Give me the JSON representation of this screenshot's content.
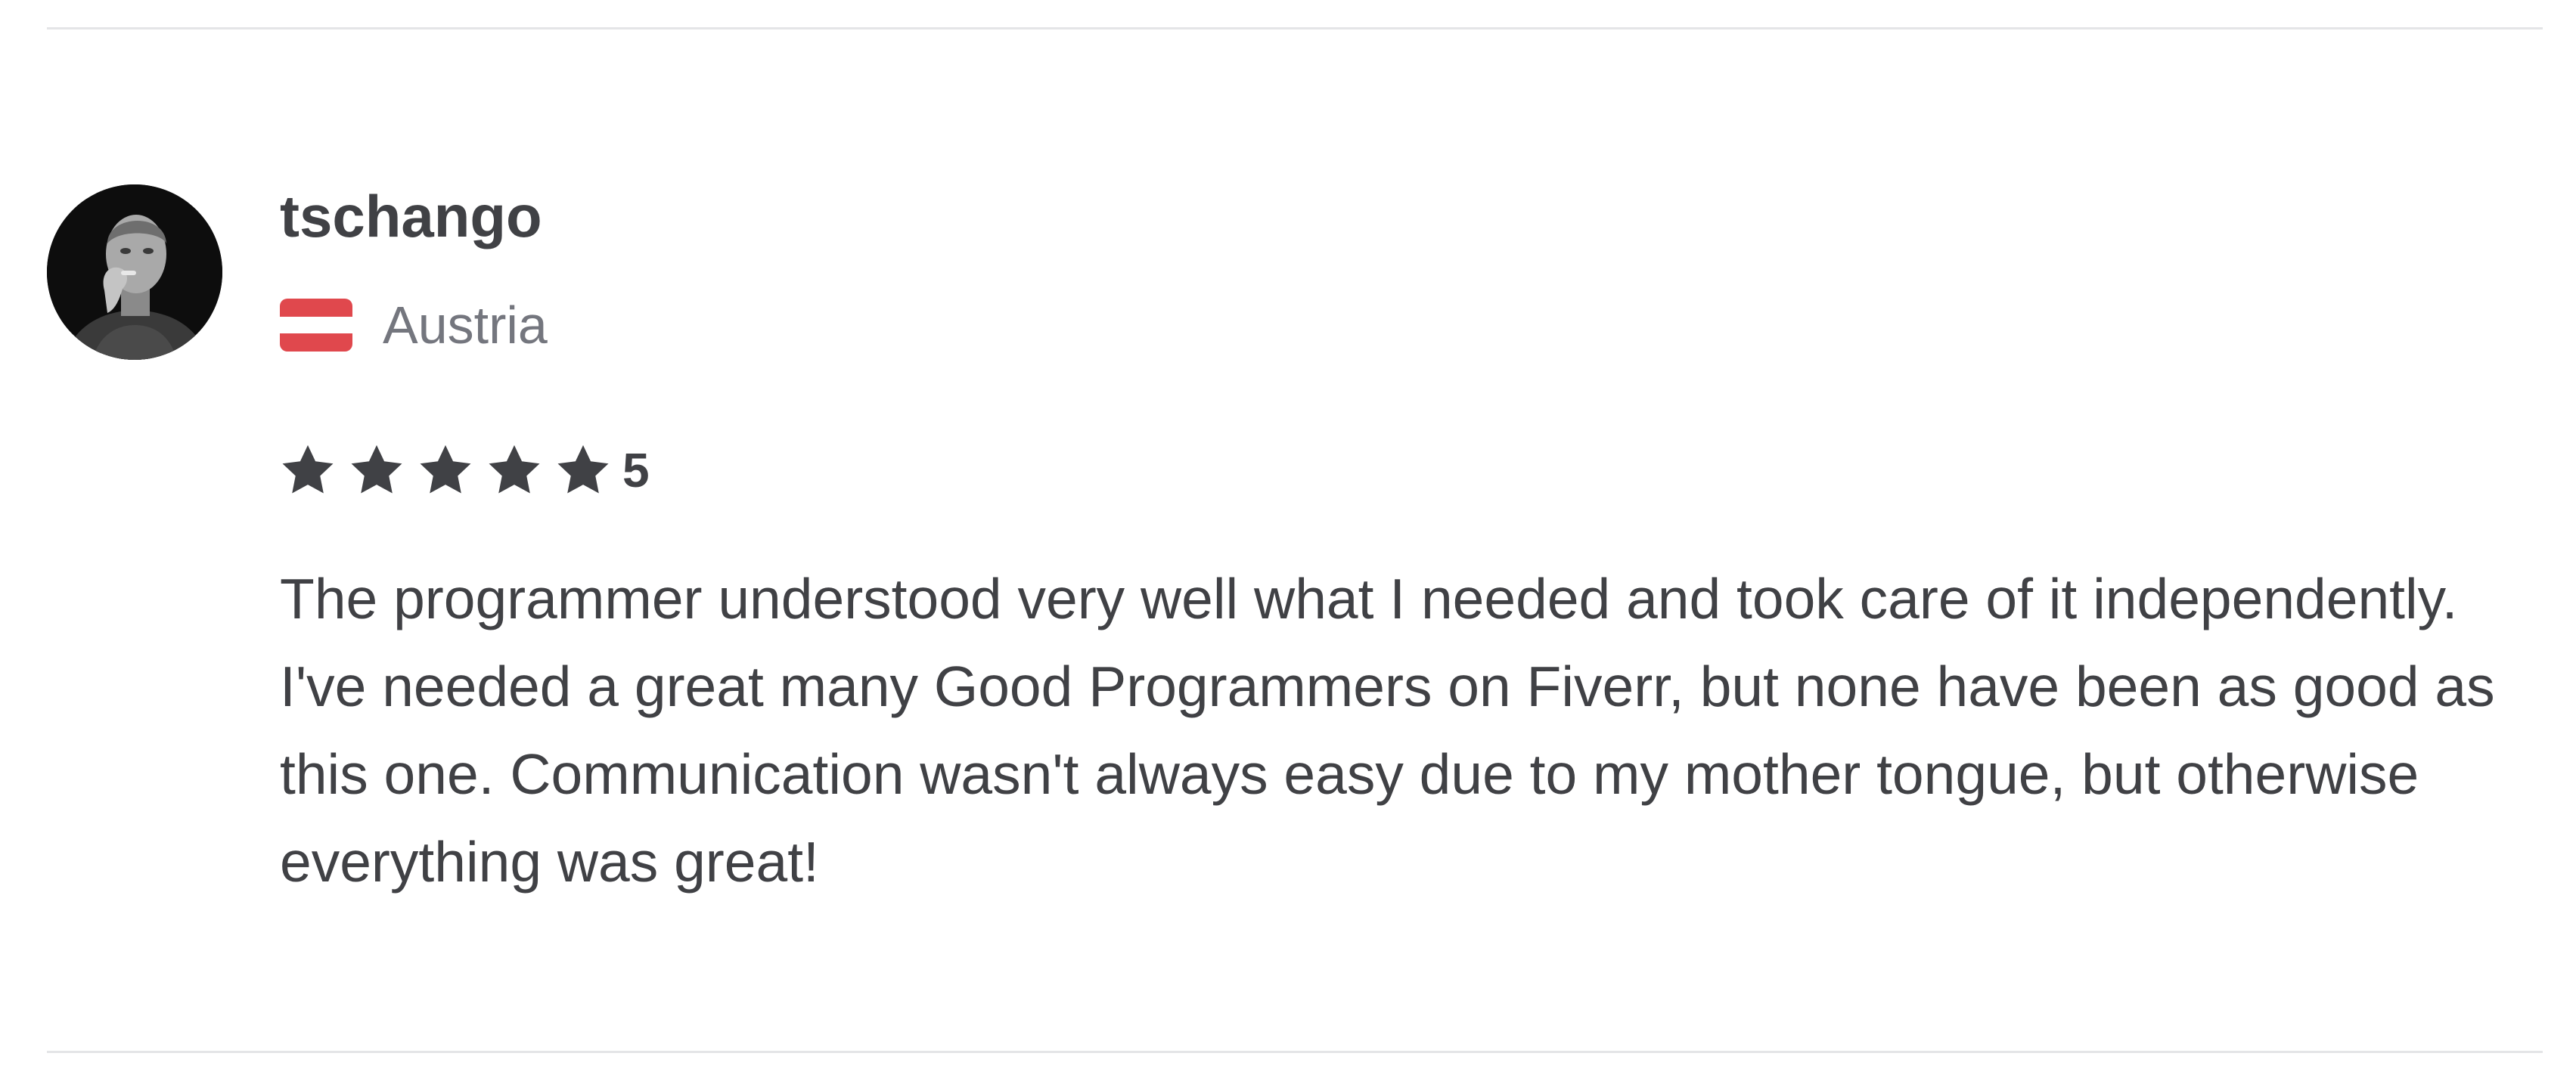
{
  "review": {
    "username": "tschango",
    "country": "Austria",
    "rating": {
      "value": "5",
      "stars": 5
    },
    "text": "The programmer understood very well what I needed and took care of it independently. I've needed a great many Good Programmers on Fiverr, but none have been as good as this one. Communication wasn't always easy due to my mother tongue, but otherwise everything was great!"
  },
  "icons": {
    "avatar": "user-avatar-photo",
    "flag": "austria-flag-icon",
    "star": "star-icon"
  },
  "colors": {
    "text_primary": "#404145",
    "text_secondary": "#74767e",
    "divider": "#e4e5e7",
    "flag_red": "#e0484d",
    "flag_white": "#ffffff",
    "star": "#404145"
  }
}
